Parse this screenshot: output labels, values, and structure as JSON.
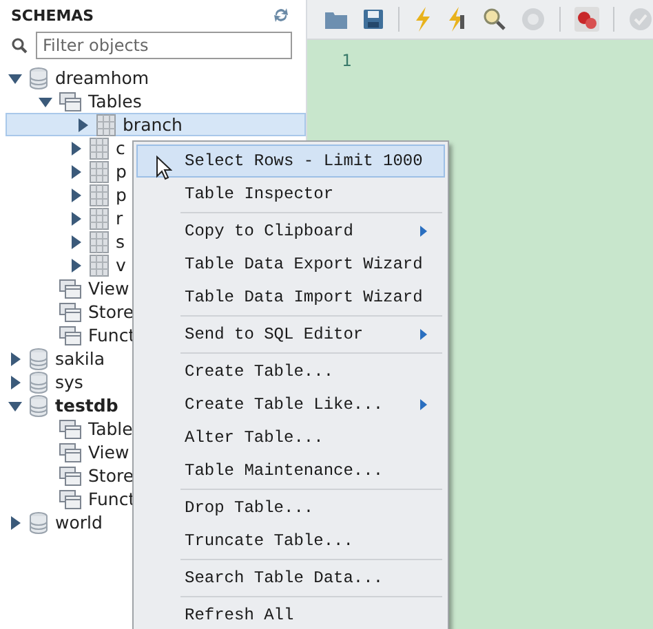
{
  "sidebar": {
    "title": "SCHEMAS",
    "filter": {
      "placeholder": "Filter objects"
    },
    "tree": [
      {
        "label": "dreamhom",
        "kind": "schema",
        "expanded": true,
        "default": false,
        "children": [
          {
            "label": "Tables",
            "kind": "folder",
            "expanded": true,
            "children": [
              {
                "label": "branch",
                "kind": "table",
                "expanded": false,
                "selected": true
              },
              {
                "label": "c",
                "kind": "table",
                "expanded": false,
                "selected": false
              },
              {
                "label": "p",
                "kind": "table",
                "expanded": false,
                "selected": false
              },
              {
                "label": "p",
                "kind": "table",
                "expanded": false,
                "selected": false
              },
              {
                "label": "r",
                "kind": "table",
                "expanded": false,
                "selected": false
              },
              {
                "label": "s",
                "kind": "table",
                "expanded": false,
                "selected": false
              },
              {
                "label": "v",
                "kind": "table",
                "expanded": false,
                "selected": false
              }
            ]
          },
          {
            "label": "View",
            "kind": "folder"
          },
          {
            "label": "Store",
            "kind": "folder"
          },
          {
            "label": "Funct",
            "kind": "folder"
          }
        ]
      },
      {
        "label": "sakila",
        "kind": "schema",
        "expanded": false,
        "default": false
      },
      {
        "label": "sys",
        "kind": "schema",
        "expanded": false,
        "default": false
      },
      {
        "label": "testdb",
        "kind": "schema",
        "expanded": true,
        "default": true,
        "children": [
          {
            "label": "Table",
            "kind": "folder"
          },
          {
            "label": "View",
            "kind": "folder"
          },
          {
            "label": "Store",
            "kind": "folder"
          },
          {
            "label": "Funct",
            "kind": "folder"
          }
        ]
      },
      {
        "label": "world",
        "kind": "schema",
        "expanded": false,
        "default": false
      }
    ]
  },
  "editor": {
    "line_numbers": [
      "1"
    ]
  },
  "context_menu": {
    "groups": [
      [
        {
          "label": "Select Rows - Limit 1000",
          "selected": true,
          "submenu": false
        },
        {
          "label": "Table Inspector",
          "selected": false,
          "submenu": false
        }
      ],
      [
        {
          "label": "Copy to Clipboard",
          "selected": false,
          "submenu": true
        },
        {
          "label": "Table Data Export Wizard",
          "selected": false,
          "submenu": false
        },
        {
          "label": "Table Data Import Wizard",
          "selected": false,
          "submenu": false
        }
      ],
      [
        {
          "label": "Send to SQL Editor",
          "selected": false,
          "submenu": true
        }
      ],
      [
        {
          "label": "Create Table...",
          "selected": false,
          "submenu": false
        },
        {
          "label": "Create Table Like...",
          "selected": false,
          "submenu": true
        },
        {
          "label": "Alter Table...",
          "selected": false,
          "submenu": false
        },
        {
          "label": "Table Maintenance...",
          "selected": false,
          "submenu": false
        }
      ],
      [
        {
          "label": "Drop Table...",
          "selected": false,
          "submenu": false
        },
        {
          "label": "Truncate Table...",
          "selected": false,
          "submenu": false
        }
      ],
      [
        {
          "label": "Search Table Data...",
          "selected": false,
          "submenu": false
        }
      ],
      [
        {
          "label": "Refresh All",
          "selected": false,
          "submenu": false
        }
      ]
    ]
  }
}
